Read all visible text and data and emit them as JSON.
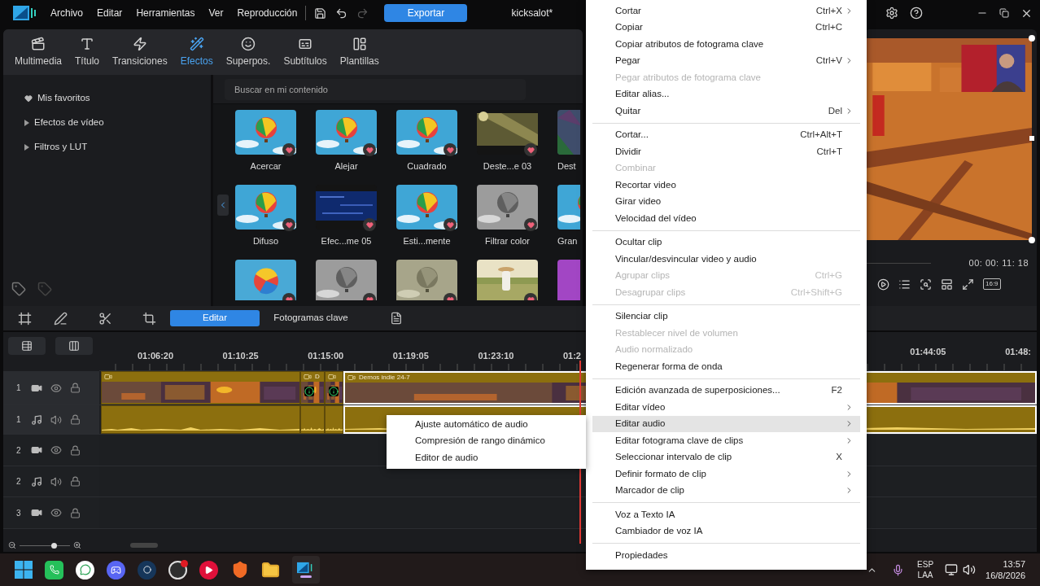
{
  "title_bar": {
    "menus": [
      "Archivo",
      "Editar",
      "Herramientas",
      "Ver",
      "Reproducción"
    ],
    "export_button": "Exportar",
    "project_title": "kicksalot*"
  },
  "module_tabs": [
    {
      "label": "Multimedia",
      "selected": false
    },
    {
      "label": "Título",
      "selected": false
    },
    {
      "label": "Transiciones",
      "selected": false
    },
    {
      "label": "Efectos",
      "selected": true
    },
    {
      "label": "Superpos.",
      "selected": false
    },
    {
      "label": "Subtítulos",
      "selected": false
    },
    {
      "label": "Plantillas",
      "selected": false
    }
  ],
  "sidebar": {
    "items": [
      {
        "kind": "favorites",
        "label": "Mis favoritos"
      },
      {
        "kind": "folder",
        "label": "Efectos de vídeo",
        "expanded": false
      },
      {
        "kind": "folder",
        "label": "Filtros y LUT",
        "expanded": false
      }
    ]
  },
  "library": {
    "search": {
      "placeholder": "Buscar en mi contenido"
    },
    "items": [
      {
        "label": "Acercar",
        "favorite": true
      },
      {
        "label": "Alejar",
        "favorite": true
      },
      {
        "label": "Cuadrado",
        "favorite": true
      },
      {
        "label": "Deste...e 03",
        "favorite": true
      },
      {
        "label": "Dest",
        "favorite": false
      },
      {
        "label": "Difuso",
        "favorite": true
      },
      {
        "label": "Efec...me 05",
        "favorite": true
      },
      {
        "label": "Esti...mente",
        "favorite": true
      },
      {
        "label": "Filtrar color",
        "favorite": true
      },
      {
        "label": "Gran",
        "favorite": false
      },
      {
        "favorite": true
      },
      {
        "favorite": true
      },
      {
        "favorite": true
      },
      {
        "favorite": true
      },
      {
        "favorite": false
      }
    ]
  },
  "edit_toolbar": {
    "tabs": [
      {
        "label": "Editar",
        "selected": true
      },
      {
        "label": "Fotogramas clave",
        "selected": false
      }
    ]
  },
  "timeline": {
    "ruler_left": [
      "01:06:20",
      "01:10:25",
      "01:15:00",
      "01:19:05",
      "01:23:10",
      "01:2"
    ],
    "ruler_right": [
      "01:44:05",
      "01:48:"
    ],
    "tracks": [
      {
        "number": "1",
        "kind": "video",
        "clips": [
          {
            "selected": false
          },
          {
            "label": "D",
            "selected": false
          },
          {
            "selected": false
          },
          {
            "label": "Demos indie 24-7",
            "selected": true
          }
        ]
      },
      {
        "number": "1",
        "kind": "audio",
        "clips": [
          {
            "selected": false
          },
          {
            "selected": false
          },
          {
            "selected": false
          },
          {
            "selected": true
          }
        ]
      },
      {
        "number": "2",
        "kind": "video"
      },
      {
        "number": "2",
        "kind": "audio"
      },
      {
        "number": "3",
        "kind": "video"
      }
    ],
    "zoom": {
      "level": 0.7
    }
  },
  "preview": {
    "timecode": "00: 00: 11: 18",
    "aspect": "16:9"
  },
  "context_menu": {
    "groups": [
      [
        {
          "label": "Cortar",
          "shortcut": "Ctrl+X",
          "submenu": true,
          "disabled": false,
          "selected": false
        },
        {
          "label": "Copiar",
          "shortcut": "Ctrl+C",
          "submenu": false,
          "disabled": false,
          "selected": false
        },
        {
          "label": "Copiar atributos de fotograma clave",
          "submenu": false,
          "disabled": false,
          "selected": false
        },
        {
          "label": "Pegar",
          "shortcut": "Ctrl+V",
          "submenu": true,
          "disabled": false,
          "selected": false
        },
        {
          "label": "Pegar atributos de fotograma clave",
          "submenu": false,
          "disabled": true,
          "selected": false
        },
        {
          "label": "Editar alias...",
          "submenu": false,
          "disabled": false,
          "selected": false
        },
        {
          "label": "Quitar",
          "shortcut": "Del",
          "submenu": true,
          "disabled": false,
          "selected": false
        }
      ],
      [
        {
          "label": "Cortar...",
          "shortcut": "Ctrl+Alt+T",
          "submenu": false,
          "disabled": false,
          "selected": false
        },
        {
          "label": "Dividir",
          "shortcut": "Ctrl+T",
          "submenu": false,
          "disabled": false,
          "selected": false
        },
        {
          "label": "Combinar",
          "submenu": false,
          "disabled": true,
          "selected": false
        },
        {
          "label": "Recortar video",
          "submenu": false,
          "disabled": false,
          "selected": false
        },
        {
          "label": "Girar video",
          "submenu": false,
          "disabled": false,
          "selected": false
        },
        {
          "label": "Velocidad del vídeo",
          "submenu": false,
          "disabled": false,
          "selected": false
        }
      ],
      [
        {
          "label": "Ocultar clip",
          "submenu": false,
          "disabled": false,
          "selected": false
        },
        {
          "label": "Vincular/desvincular video y audio",
          "submenu": false,
          "disabled": false,
          "selected": false
        },
        {
          "label": "Agrupar clips",
          "shortcut": "Ctrl+G",
          "submenu": false,
          "disabled": true,
          "selected": false
        },
        {
          "label": "Desagrupar clips",
          "shortcut": "Ctrl+Shift+G",
          "submenu": false,
          "disabled": true,
          "selected": false
        }
      ],
      [
        {
          "label": "Silenciar clip",
          "submenu": false,
          "disabled": false,
          "selected": false
        },
        {
          "label": "Restablecer nivel de volumen",
          "submenu": false,
          "disabled": true,
          "selected": false
        },
        {
          "label": "Audio normalizado",
          "submenu": false,
          "disabled": true,
          "selected": false
        },
        {
          "label": "Regenerar forma de onda",
          "submenu": false,
          "disabled": false,
          "selected": false
        }
      ],
      [
        {
          "label": "Edición avanzada de superposiciones...",
          "shortcut": "F2",
          "submenu": false,
          "disabled": false,
          "selected": false
        },
        {
          "label": "Editar vídeo",
          "submenu": true,
          "disabled": false,
          "selected": false
        },
        {
          "label": "Editar audio",
          "submenu": true,
          "disabled": false,
          "selected": true
        },
        {
          "label": "Editar fotograma clave de clips",
          "submenu": true,
          "disabled": false,
          "selected": false
        },
        {
          "label": "Seleccionar intervalo de clip",
          "shortcut": "X",
          "submenu": false,
          "disabled": false,
          "selected": false
        },
        {
          "label": "Definir formato de clip",
          "submenu": true,
          "disabled": false,
          "selected": false
        },
        {
          "label": "Marcador de clip",
          "submenu": true,
          "disabled": false,
          "selected": false
        }
      ],
      [
        {
          "label": "Voz a Texto IA",
          "submenu": false,
          "disabled": false,
          "selected": false
        },
        {
          "label": "Cambiador de voz IA",
          "submenu": false,
          "disabled": false,
          "selected": false
        }
      ],
      [
        {
          "label": "Propiedades",
          "submenu": false,
          "disabled": false,
          "selected": false
        }
      ]
    ]
  },
  "submenu": {
    "items": [
      "Ajuste automático de audio",
      "Compresión de rango dinámico",
      "Editor de audio"
    ]
  },
  "taskbar": {
    "language": [
      "ESP",
      "LAA"
    ],
    "time": "13:57",
    "date": "16/8/2026"
  }
}
